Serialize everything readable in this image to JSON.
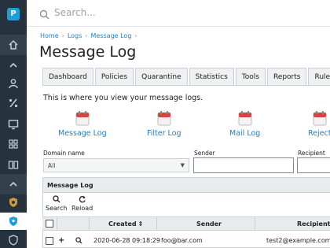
{
  "sidebar": {
    "logo": "P",
    "icons": [
      "home-icon",
      "chevron-up-icon",
      "user-icon",
      "percent-icon",
      "monitor-icon",
      "grid-icon",
      "book-icon",
      "chevron-up-icon",
      "shield-gear-icon",
      "shield-icon",
      "shield-active-icon"
    ]
  },
  "search": {
    "placeholder": "Search..."
  },
  "breadcrumb": {
    "items": [
      "Home",
      "Logs",
      "Message Log"
    ]
  },
  "page": {
    "title": "Message Log",
    "intro": "This is where you view your message logs."
  },
  "tabs": [
    "Dashboard",
    "Policies",
    "Quarantine",
    "Statistics",
    "Tools",
    "Reports",
    "Rules"
  ],
  "actions": [
    "Message Log",
    "Filter Log",
    "Mail Log",
    "Reject"
  ],
  "filters": {
    "domain_label": "Domain name",
    "domain_value": "All",
    "sender_label": "Sender",
    "recipient_label": "Recipient"
  },
  "panel": {
    "title": "Message Log",
    "search_label": "Search",
    "reload_label": "Reload"
  },
  "table": {
    "columns": {
      "created": "Created",
      "sender": "Sender",
      "recipient": "Recipient"
    },
    "rows": [
      {
        "created": "2020-06-28 09:18:29",
        "sender": "foo@bar.com",
        "recipient": "test2@example.com"
      }
    ]
  },
  "colors": {
    "sidebar": "#26323d",
    "link": "#1f7fbf",
    "accent": "#1d9fd8",
    "calendar_red": "#d64541"
  }
}
